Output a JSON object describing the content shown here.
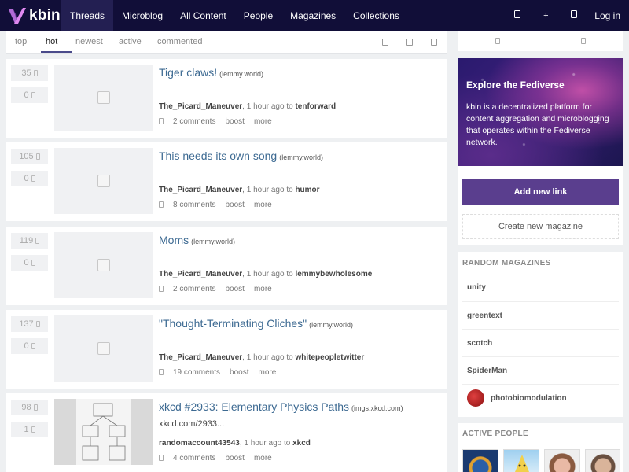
{
  "app": {
    "logo_text": "kbin"
  },
  "nav": {
    "items": [
      {
        "label": "Threads",
        "active": true
      },
      {
        "label": "Microblog",
        "active": false
      },
      {
        "label": "All Content",
        "active": false
      },
      {
        "label": "People",
        "active": false
      },
      {
        "label": "Magazines",
        "active": false
      },
      {
        "label": "Collections",
        "active": false
      }
    ],
    "right_icons": [
      "search-icon",
      "plus-icon",
      "settings-icon"
    ],
    "plus_glyph": "+",
    "login": "Log in"
  },
  "sort": {
    "tabs": [
      "top",
      "hot",
      "newest",
      "active",
      "commented"
    ],
    "active": "hot",
    "icons": [
      "filter-icon",
      "layout-icon",
      "view-icon"
    ]
  },
  "threads": [
    {
      "score": "35",
      "down": "0",
      "title": "Tiger claws!",
      "domain": "(lemmy.world)",
      "author": "The_Picard_Maneuver",
      "time": ", 1 hour ago to ",
      "magazine": "tenforward",
      "comments": "2 comments",
      "boost": "boost",
      "more": "more",
      "url": ""
    },
    {
      "score": "105",
      "down": "0",
      "title": "This needs its own song",
      "domain": "(lemmy.world)",
      "author": "The_Picard_Maneuver",
      "time": ", 1 hour ago to ",
      "magazine": "humor",
      "comments": "8 comments",
      "boost": "boost",
      "more": "more",
      "url": ""
    },
    {
      "score": "119",
      "down": "0",
      "title": "Moms",
      "domain": "(lemmy.world)",
      "author": "The_Picard_Maneuver",
      "time": ", 1 hour ago to ",
      "magazine": "lemmybewholesome",
      "comments": "2 comments",
      "boost": "boost",
      "more": "more",
      "url": ""
    },
    {
      "score": "137",
      "down": "0",
      "title": "\"Thought-Terminating Cliches\"",
      "domain": "(lemmy.world)",
      "author": "The_Picard_Maneuver",
      "time": ", 1 hour ago to ",
      "magazine": "whitepeopletwitter",
      "comments": "19 comments",
      "boost": "boost",
      "more": "more",
      "url": ""
    },
    {
      "score": "98",
      "down": "1",
      "title": "xkcd #2933: Elementary Physics Paths",
      "domain": "(imgs.xkcd.com)",
      "author": "randomaccount43543",
      "time": ", 1 hour ago to ",
      "magazine": "xkcd",
      "comments": "4 comments",
      "boost": "boost",
      "more": "more",
      "url": "xkcd.com/2933..."
    }
  ],
  "sidebar": {
    "hero_title": "Explore the Fediverse",
    "hero_text": "kbin is a decentralized platform for content aggregation and microblogging that operates within the Fediverse network.",
    "add_link": "Add new link",
    "create_magazine": "Create new magazine",
    "random_heading": "RANDOM MAGAZINES",
    "magazines": [
      "unity",
      "greentext",
      "scotch",
      "SpiderMan",
      "photobiomodulation"
    ],
    "people_heading": "ACTIVE PEOPLE"
  },
  "colors": {
    "nav_bg": "#110e38",
    "accent": "#5a3e8e",
    "title_link": "#3d6a92"
  }
}
